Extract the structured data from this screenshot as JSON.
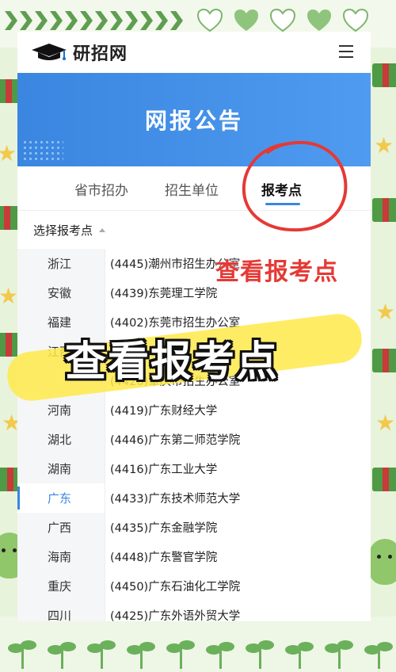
{
  "app": {
    "logo_text": "研招网",
    "banner_title": "网报公告"
  },
  "tabs": [
    {
      "label": "省市招办",
      "active": false
    },
    {
      "label": "招生单位",
      "active": false
    },
    {
      "label": "报考点",
      "active": true
    }
  ],
  "select": {
    "label": "选择报考点"
  },
  "provinces": [
    {
      "label": "浙江",
      "active": false
    },
    {
      "label": "安徽",
      "active": false
    },
    {
      "label": "福建",
      "active": false
    },
    {
      "label": "江西",
      "active": false
    },
    {
      "label": "",
      "active": false
    },
    {
      "label": "河南",
      "active": false
    },
    {
      "label": "湖北",
      "active": false
    },
    {
      "label": "湖南",
      "active": false
    },
    {
      "label": "广东",
      "active": true
    },
    {
      "label": "广西",
      "active": false
    },
    {
      "label": "海南",
      "active": false
    },
    {
      "label": "重庆",
      "active": false
    },
    {
      "label": "四川",
      "active": false
    }
  ],
  "schools": [
    "(4445)潮州市招生办公室",
    "(4439)东莞理工学院",
    "(4402)东莞市招生办公室",
    "",
    "(4420)肇庆市招生办公室",
    "(4419)广东财经大学",
    "(4446)广东第二师范学院",
    "(4416)广东工业大学",
    "(4433)广东技术师范大学",
    "(4435)广东金融学院",
    "(4448)广东警官学院",
    "(4450)广东石油化工学院",
    "(4425)广东外语外贸大学"
  ],
  "overlay": {
    "annotation_red": "查看报考点",
    "big_title": "查看报考点"
  },
  "colors": {
    "accent": "#3a86e0",
    "annotation": "#e53935",
    "highlight": "#ffe94a",
    "frame_green": "#5f9e52"
  },
  "icons": {
    "logo": "graduation-cap-icon",
    "menu": "hamburger-menu-icon",
    "caret": "caret-up-icon"
  }
}
